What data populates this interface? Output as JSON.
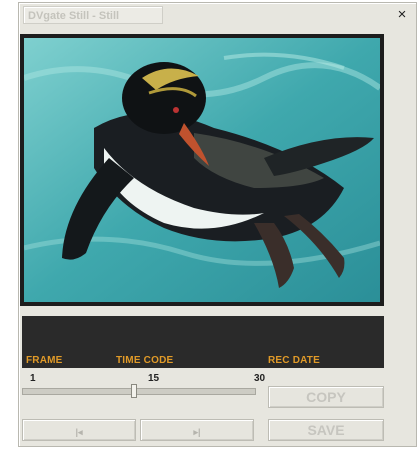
{
  "window": {
    "title": "DVgate Still - Still",
    "close_label": "×"
  },
  "preview": {
    "subject": "penguin-swimming-image"
  },
  "info_bar": {
    "frame_label": "FRAME",
    "timecode_label": "TIME CODE",
    "recdate_label": "REC DATE"
  },
  "slider": {
    "min_label": "1",
    "mid_label": "15",
    "max_label": "30",
    "value": 15,
    "min": 1,
    "max": 30
  },
  "buttons": {
    "prev_glyph": "|◂",
    "next_glyph": "▸|",
    "copy_label": "COPY",
    "save_label": "SAVE"
  },
  "colors": {
    "window_bg": "#e7e6df",
    "info_bar_bg": "#2a2a2a",
    "info_label": "#e09a28",
    "disabled_text": "#c6c5bf"
  }
}
